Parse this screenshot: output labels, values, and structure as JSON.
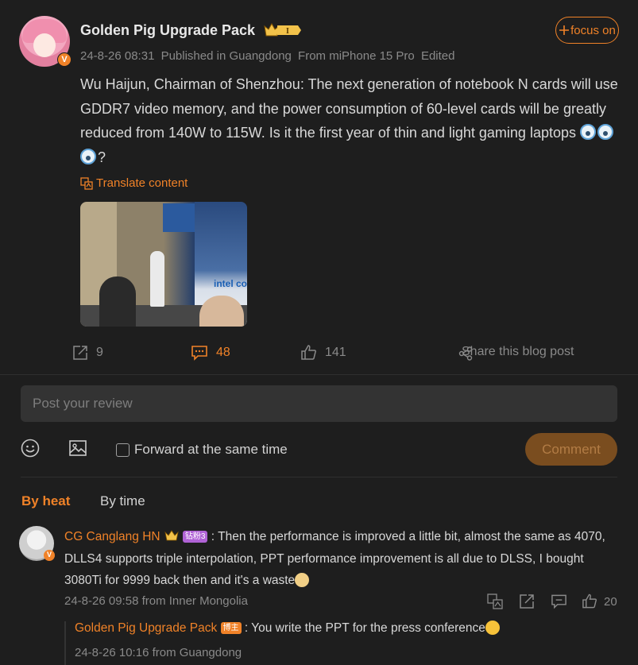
{
  "post": {
    "author": "Golden Pig Upgrade Pack",
    "level_badge": "I",
    "meta": {
      "time": "24-8-26 08:31",
      "published_in": "Published in Guangdong",
      "source": "From miPhone 15 Pro",
      "edited": "Edited"
    },
    "focus_label": "focus on",
    "text": "Wu Haijun, Chairman of Shenzhou: The next generation of notebook N cards will use GDDR7 video memory, and the power consumption of 60-level cards will be greatly reduced from 140W to 115W. Is it the first year of thin and light gaming laptops",
    "text_end": "?",
    "translate_label": "Translate content",
    "photo_brand": "intel co",
    "actions": {
      "repost_count": "9",
      "comment_count": "48",
      "like_count": "141",
      "share_label": "Share this blog post"
    }
  },
  "composer": {
    "placeholder": "Post your review",
    "forward_label": "Forward at the same time",
    "comment_button": "Comment"
  },
  "tabs": {
    "heat": "By heat",
    "time": "By time"
  },
  "comments": [
    {
      "user": "CG Canglang HN",
      "fan_badge": "钻粉3",
      "text": ": Then the performance is improved a little bit, almost the same as 4070, DLLS4 supports triple interpolation, PPT performance improvement is all due to DLSS, I bought 3080Ti for 9999 back then and it's a waste",
      "meta": "24-8-26 09:58 from Inner Mongolia",
      "like_count": "20",
      "reply": {
        "user": "Golden Pig Upgrade Pack",
        "host_badge": "博主",
        "text": ": You write the PPT for the press conference",
        "meta": "24-8-26 10:16 from Guangdong"
      }
    }
  ],
  "colors": {
    "accent": "#f08228",
    "background": "#1e1e1e",
    "input_bg": "#333333"
  }
}
